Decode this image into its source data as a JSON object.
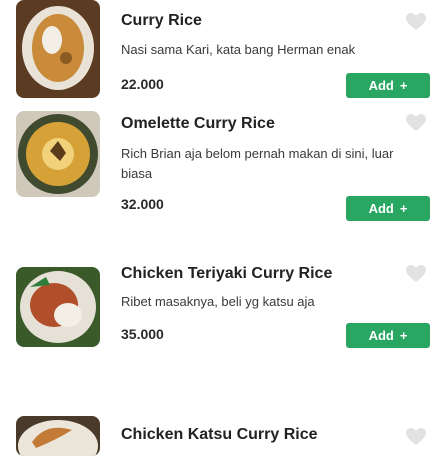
{
  "colors": {
    "add_button": "#2aa663",
    "heart": "#e2e2e2",
    "name_text": "#222222",
    "desc_text": "#3a3a3a"
  },
  "menu": {
    "items": [
      {
        "name": "Curry Rice",
        "description": "Nasi sama Kari, kata bang Herman enak",
        "price": "22.000",
        "add_label": "Add",
        "add_icon": "+",
        "icon": "heart-icon"
      },
      {
        "name": "Omelette Curry Rice",
        "description": "Rich Brian aja belom pernah makan di sini, luar biasa",
        "price": "32.000",
        "add_label": "Add",
        "add_icon": "+",
        "icon": "heart-icon"
      },
      {
        "name": "Chicken Teriyaki Curry Rice",
        "description": "Ribet masaknya, beli yg katsu aja",
        "price": "35.000",
        "add_label": "Add",
        "add_icon": "+",
        "icon": "heart-icon"
      },
      {
        "name": "Chicken Katsu Curry Rice",
        "icon": "heart-icon"
      }
    ]
  }
}
